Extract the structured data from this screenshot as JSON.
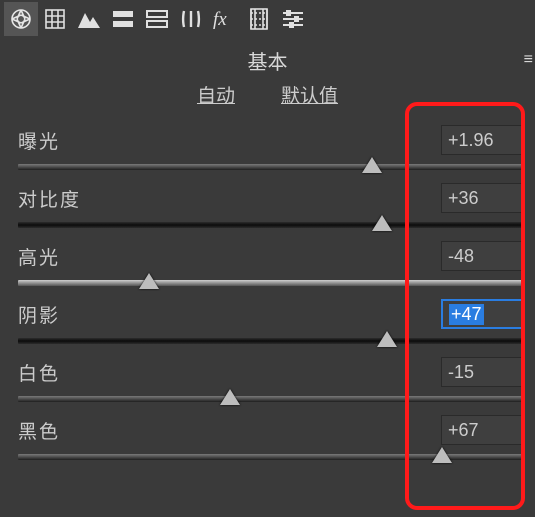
{
  "toolbar": {
    "icons": [
      {
        "name": "aperture-icon",
        "active": true
      },
      {
        "name": "grid-icon",
        "active": false
      },
      {
        "name": "mountain-icon",
        "active": false
      },
      {
        "name": "rows-solid-icon",
        "active": false
      },
      {
        "name": "rows-outline-icon",
        "active": false
      },
      {
        "name": "columns-icon",
        "active": false
      },
      {
        "name": "fx-icon",
        "active": false
      },
      {
        "name": "filmstrip-icon",
        "active": false
      },
      {
        "name": "sliders-icon",
        "active": false
      }
    ]
  },
  "panel": {
    "title": "基本",
    "menu_glyph": "≡",
    "links": {
      "auto": "自动",
      "default": "默认值"
    }
  },
  "sliders": [
    {
      "label": "曝光",
      "value": "+1.96",
      "thumb_pct": 70,
      "bar": "plain",
      "selected": false
    },
    {
      "label": "对比度",
      "value": "+36",
      "thumb_pct": 72,
      "bar": "dark",
      "selected": false
    },
    {
      "label": "高光",
      "value": "-48",
      "thumb_pct": 26,
      "bar": "light",
      "selected": false
    },
    {
      "label": "阴影",
      "value": "+47",
      "thumb_pct": 73,
      "bar": "dark",
      "selected": true
    },
    {
      "label": "白色",
      "value": "-15",
      "thumb_pct": 42,
      "bar": "plain",
      "selected": false
    },
    {
      "label": "黑色",
      "value": "+67",
      "thumb_pct": 84,
      "bar": "plain",
      "selected": false
    }
  ]
}
